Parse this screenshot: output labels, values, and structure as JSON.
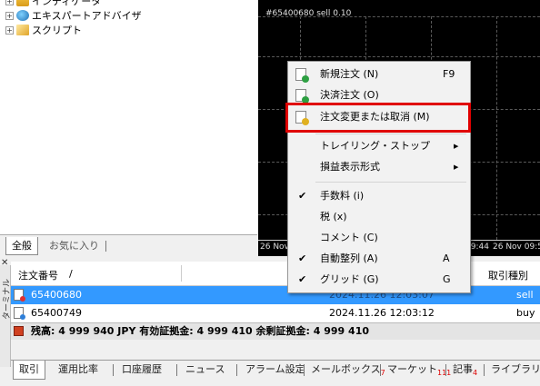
{
  "navigator": {
    "items": [
      {
        "label": "インディケータ",
        "icon": "indicators-icon"
      },
      {
        "label": "エキスパートアドバイザ",
        "icon": "expert-advisor-icon"
      },
      {
        "label": "スクリプト",
        "icon": "script-icon"
      }
    ],
    "tabs": [
      "全般",
      "お気に入り"
    ]
  },
  "chart": {
    "order_line_label": "#65400680 sell 0.10",
    "x_labels": [
      "26 Nov",
      "09:44",
      "26 Nov 09:5"
    ]
  },
  "context_menu": {
    "items": [
      {
        "label": "新規注文 (N)",
        "shortcut": "F9",
        "icon": "new-order-icon"
      },
      {
        "label": "決済注文 (O)",
        "icon": "close-order-icon"
      },
      {
        "label": "注文変更または取消 (M)",
        "icon": "modify-order-icon",
        "highlighted": true
      },
      {
        "label": "トレイリング・ストップ",
        "submenu": true
      },
      {
        "label": "損益表示形式",
        "submenu": true
      },
      {
        "label": "手数料 (i)",
        "checked": true
      },
      {
        "label": "税 (x)",
        "checked": false
      },
      {
        "label": "コメント (C)",
        "checked": false
      },
      {
        "label": "自動整列 (A)",
        "shortcut": "A",
        "checked": true
      },
      {
        "label": "グリッド (G)",
        "shortcut": "G",
        "checked": true
      }
    ],
    "highlight_color": "#e00000"
  },
  "terminal": {
    "side_label": "ターミナル",
    "columns": {
      "order_no": "注文番号",
      "sort_mark": "/",
      "type": "取引種別"
    },
    "rows": [
      {
        "order": "65400680",
        "time": "2024.11.26 12:03:07",
        "type": "sell",
        "selected": true
      },
      {
        "order": "65400749",
        "time": "2024.11.26 12:03:12",
        "type": "buy",
        "selected": false
      }
    ],
    "balance_text": "残高: 4 999 940 JPY  有効証拠金: 4 999 410  余剰証拠金: 4 999 410",
    "tabs": [
      {
        "label": "取引",
        "active": true
      },
      {
        "label": "運用比率"
      },
      {
        "label": "口座履歴"
      },
      {
        "label": "ニュース"
      },
      {
        "label": "アラーム設定"
      },
      {
        "label": "メールボックス",
        "count": "7"
      },
      {
        "label": "マーケット",
        "count": "111"
      },
      {
        "label": "記事",
        "count": "4"
      },
      {
        "label": "ライブラリ"
      }
    ]
  },
  "colors": {
    "selection": "#3399ff",
    "chart_bg": "#000000"
  }
}
